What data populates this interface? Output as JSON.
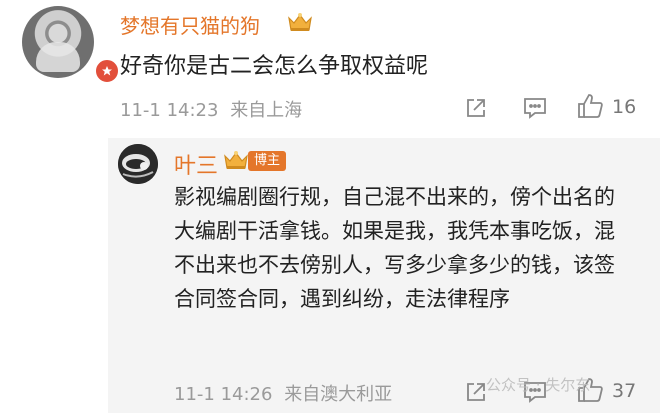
{
  "comment": {
    "username": "梦想有只猫的狗",
    "text": "好奇你是古二会怎么争取权益呢",
    "time": "11-1 14:23",
    "location": "来自上海",
    "like_count": "16"
  },
  "reply": {
    "username": "叶三",
    "badge": "博主",
    "text": "影视编剧圈行规，自己混不出来的，傍个出名的大编剧干活拿钱。如果是我，我凭本事吃饭，混不出来也不去傍别人，写多少拿多少的钱，该签合同签合同，遇到纠纷，走法律程序",
    "time": "11-1 14:26",
    "location": "来自澳大利亚",
    "like_count": "37"
  },
  "watermark": "公众号 · 失尔东",
  "colors": {
    "username": "#e4762a",
    "badge_bg": "#e4762a",
    "meta": "#9a9a9a",
    "reply_bg": "#f4f4f4",
    "verified_badge": "#e24f3b"
  },
  "icons": [
    "avatar-photo",
    "verified-icon",
    "crown-icon",
    "share-icon",
    "comment-icon",
    "like-icon"
  ]
}
